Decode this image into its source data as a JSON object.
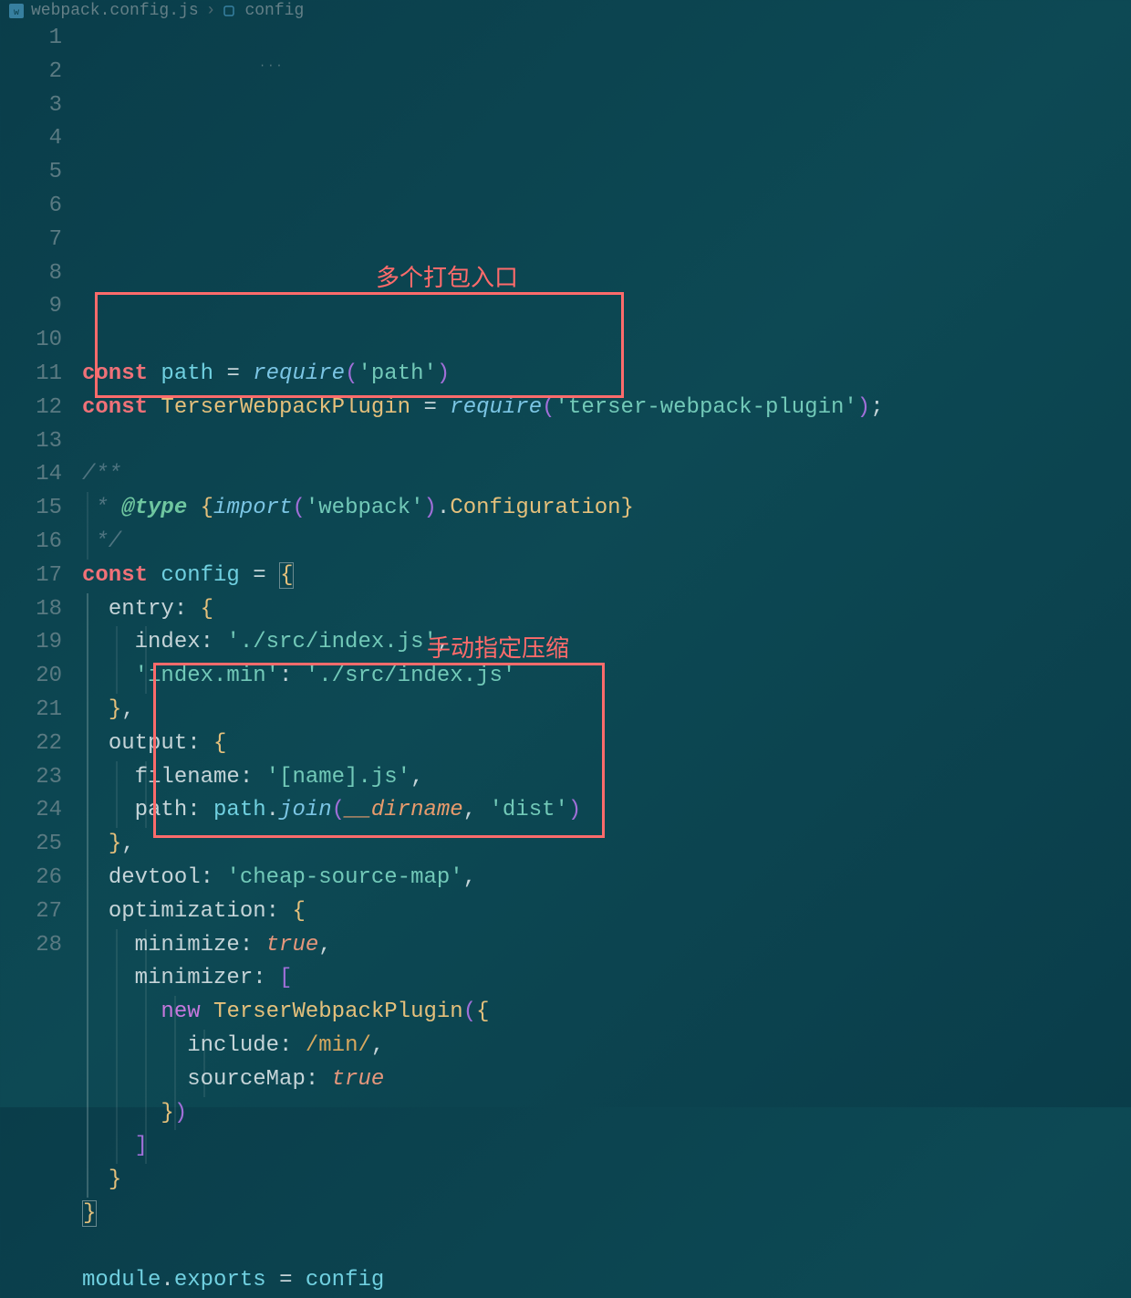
{
  "breadcrumb": {
    "file": "webpack.config.js",
    "symbol": "config"
  },
  "annotations": {
    "box1_label": "多个打包入口",
    "box2_label": "手动指定压缩"
  },
  "code": {
    "lines": [
      {
        "n": 1,
        "tokens": [
          [
            "kw",
            "const"
          ],
          [
            "op",
            " "
          ],
          [
            "var",
            "path"
          ],
          [
            "op",
            " "
          ],
          [
            "op",
            "="
          ],
          [
            "op",
            " "
          ],
          [
            "fn",
            "require"
          ],
          [
            "paren",
            "("
          ],
          [
            "str",
            "'path'"
          ],
          [
            "paren",
            ")"
          ]
        ]
      },
      {
        "n": 2,
        "tokens": [
          [
            "kw",
            "const"
          ],
          [
            "op",
            " "
          ],
          [
            "cls",
            "TerserWebpackPlugin"
          ],
          [
            "op",
            " "
          ],
          [
            "op",
            "="
          ],
          [
            "op",
            " "
          ],
          [
            "fn",
            "require"
          ],
          [
            "paren",
            "("
          ],
          [
            "str",
            "'terser-webpack-plugin'"
          ],
          [
            "paren",
            ")"
          ],
          [
            "op",
            ";"
          ]
        ]
      },
      {
        "n": 3,
        "tokens": []
      },
      {
        "n": 4,
        "tokens": [
          [
            "cmt",
            "/**"
          ]
        ]
      },
      {
        "n": 5,
        "tokens": [
          [
            "cmt",
            " * "
          ],
          [
            "tag",
            "@type"
          ],
          [
            "cmt",
            " "
          ],
          [
            "pun",
            "{"
          ],
          [
            "fn",
            "import"
          ],
          [
            "paren",
            "("
          ],
          [
            "str",
            "'webpack'"
          ],
          [
            "paren",
            ")"
          ],
          [
            "op",
            "."
          ],
          [
            "type",
            "Configuration"
          ],
          [
            "pun",
            "}"
          ]
        ]
      },
      {
        "n": 6,
        "tokens": [
          [
            "cmt",
            " */"
          ]
        ]
      },
      {
        "n": 7,
        "tokens": [
          [
            "kw",
            "const"
          ],
          [
            "op",
            " "
          ],
          [
            "var",
            "config"
          ],
          [
            "op",
            " "
          ],
          [
            "op",
            "="
          ],
          [
            "op",
            " "
          ],
          [
            "punhl",
            "{"
          ]
        ]
      },
      {
        "n": 8,
        "tokens": [
          [
            "op",
            "  "
          ],
          [
            "prop",
            "entry"
          ],
          [
            "op",
            ":"
          ],
          [
            "op",
            " "
          ],
          [
            "pun",
            "{"
          ]
        ]
      },
      {
        "n": 9,
        "tokens": [
          [
            "op",
            "    "
          ],
          [
            "prop",
            "index"
          ],
          [
            "op",
            ":"
          ],
          [
            "op",
            " "
          ],
          [
            "str",
            "'./src/index.js'"
          ],
          [
            "op",
            ","
          ]
        ]
      },
      {
        "n": 10,
        "tokens": [
          [
            "op",
            "    "
          ],
          [
            "str",
            "'index.min'"
          ],
          [
            "op",
            ":"
          ],
          [
            "op",
            " "
          ],
          [
            "str",
            "'./src/index.js'"
          ]
        ]
      },
      {
        "n": 11,
        "tokens": [
          [
            "op",
            "  "
          ],
          [
            "pun",
            "}"
          ],
          [
            "op",
            ","
          ]
        ]
      },
      {
        "n": 12,
        "tokens": [
          [
            "op",
            "  "
          ],
          [
            "prop",
            "output"
          ],
          [
            "op",
            ":"
          ],
          [
            "op",
            " "
          ],
          [
            "pun",
            "{"
          ]
        ]
      },
      {
        "n": 13,
        "tokens": [
          [
            "op",
            "    "
          ],
          [
            "prop",
            "filename"
          ],
          [
            "op",
            ":"
          ],
          [
            "op",
            " "
          ],
          [
            "str",
            "'[name].js'"
          ],
          [
            "op",
            ","
          ]
        ]
      },
      {
        "n": 14,
        "tokens": [
          [
            "op",
            "    "
          ],
          [
            "prop",
            "path"
          ],
          [
            "op",
            ":"
          ],
          [
            "op",
            " "
          ],
          [
            "var",
            "path"
          ],
          [
            "op",
            "."
          ],
          [
            "fn",
            "join"
          ],
          [
            "paren",
            "("
          ],
          [
            "paramkw",
            "__dirname"
          ],
          [
            "op",
            ","
          ],
          [
            "op",
            " "
          ],
          [
            "str",
            "'dist'"
          ],
          [
            "paren",
            ")"
          ]
        ]
      },
      {
        "n": 15,
        "tokens": [
          [
            "op",
            "  "
          ],
          [
            "pun",
            "}"
          ],
          [
            "op",
            ","
          ]
        ]
      },
      {
        "n": 16,
        "tokens": [
          [
            "op",
            "  "
          ],
          [
            "prop",
            "devtool"
          ],
          [
            "op",
            ":"
          ],
          [
            "op",
            " "
          ],
          [
            "str",
            "'cheap-source-map'"
          ],
          [
            "op",
            ","
          ]
        ]
      },
      {
        "n": 17,
        "tokens": [
          [
            "op",
            "  "
          ],
          [
            "prop",
            "optimization"
          ],
          [
            "op",
            ":"
          ],
          [
            "op",
            " "
          ],
          [
            "pun",
            "{"
          ]
        ]
      },
      {
        "n": 18,
        "tokens": [
          [
            "op",
            "    "
          ],
          [
            "prop",
            "minimize"
          ],
          [
            "op",
            ":"
          ],
          [
            "op",
            " "
          ],
          [
            "bool",
            "true"
          ],
          [
            "op",
            ","
          ]
        ]
      },
      {
        "n": 19,
        "tokens": [
          [
            "op",
            "    "
          ],
          [
            "prop",
            "minimizer"
          ],
          [
            "op",
            ":"
          ],
          [
            "op",
            " "
          ],
          [
            "paren",
            "["
          ]
        ]
      },
      {
        "n": 20,
        "tokens": [
          [
            "op",
            "      "
          ],
          [
            "kw2",
            "new"
          ],
          [
            "op",
            " "
          ],
          [
            "cls",
            "TerserWebpackPlugin"
          ],
          [
            "paren",
            "("
          ],
          [
            "pun",
            "{"
          ]
        ]
      },
      {
        "n": 21,
        "tokens": [
          [
            "op",
            "        "
          ],
          [
            "prop",
            "include"
          ],
          [
            "op",
            ":"
          ],
          [
            "op",
            " "
          ],
          [
            "regex",
            "/min/"
          ],
          [
            "op",
            ","
          ]
        ]
      },
      {
        "n": 22,
        "tokens": [
          [
            "op",
            "        "
          ],
          [
            "prop",
            "sourceMap"
          ],
          [
            "op",
            ":"
          ],
          [
            "op",
            " "
          ],
          [
            "bool",
            "true"
          ]
        ]
      },
      {
        "n": 23,
        "tokens": [
          [
            "op",
            "      "
          ],
          [
            "pun",
            "}"
          ],
          [
            "paren",
            ")"
          ]
        ]
      },
      {
        "n": 24,
        "tokens": [
          [
            "op",
            "    "
          ],
          [
            "paren",
            "]"
          ]
        ]
      },
      {
        "n": 25,
        "tokens": [
          [
            "op",
            "  "
          ],
          [
            "pun",
            "}"
          ]
        ]
      },
      {
        "n": 26,
        "tokens": [
          [
            "punhl",
            "}"
          ]
        ]
      },
      {
        "n": 27,
        "tokens": []
      },
      {
        "n": 28,
        "tokens": [
          [
            "var",
            "module"
          ],
          [
            "op",
            "."
          ],
          [
            "var",
            "exports"
          ],
          [
            "op",
            " "
          ],
          [
            "op",
            "="
          ],
          [
            "op",
            " "
          ],
          [
            "var",
            "config"
          ]
        ]
      }
    ]
  }
}
